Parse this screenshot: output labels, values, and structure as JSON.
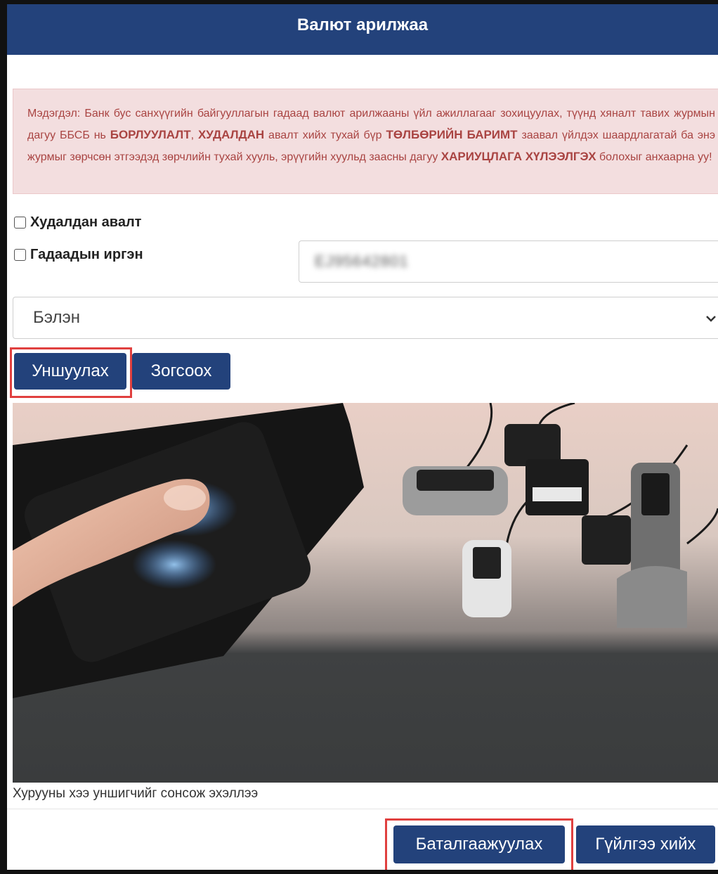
{
  "header": {
    "title": "Валют арилжаа"
  },
  "alert": {
    "t1": "Мэдэгдэл: Банк бус санхүүгийн байгууллагын гадаад валют арилжааны үйл ажиллагааг зохицуулах, түүнд хяналт тавих журмын дагуу ББСБ нь ",
    "b1": "БОРЛУУЛАЛТ",
    "t2": ", ",
    "b2": "ХУДАЛДАН",
    "t3": " авалт хийх тухай бүр ",
    "b3": "ТӨЛБӨРИЙН БАРИМТ",
    "t4": " заавал үйлдэх шаардлагатай ба энэ журмыг зөрчсөн этгээдэд зөрчлийн тухай хууль, эрүүгийн хуульд заасны дагуу ",
    "b4": "ХАРИУЦЛАГА ХҮЛЭЭЛГЭХ",
    "t5": " болохыг анхаарна уу!"
  },
  "form": {
    "purchase_label": "Худалдан авалт",
    "foreigner_label": "Гадаадын иргэн",
    "id_value": "EJ95642801",
    "payment_selected": "Бэлэн"
  },
  "buttons": {
    "scan": "Уншуулах",
    "stop": "Зогсоох",
    "verify": "Баталгаажуулах",
    "transact": "Гүйлгээ хийх"
  },
  "status": {
    "caption": "Хурууны хээ уншигчийг сонсож эхэллээ"
  },
  "icons": {
    "select_chevron": "chevron-down-icon"
  },
  "colors": {
    "primary": "#23427b",
    "alert_bg": "#f3dedf",
    "alert_text": "#a94442",
    "highlight": "#e0403f"
  }
}
